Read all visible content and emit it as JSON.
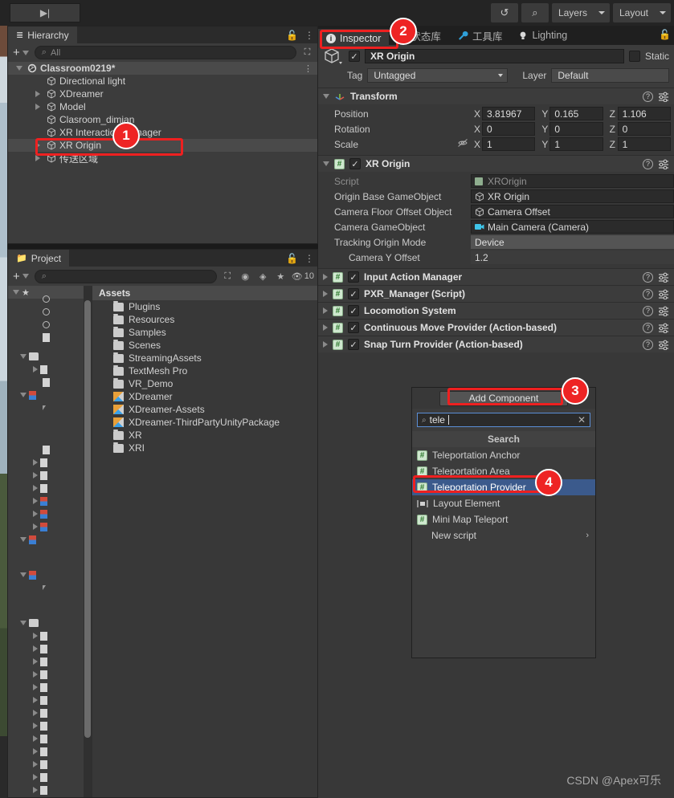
{
  "toolbar": {
    "play_icon": "▶",
    "step_icon": "▶|",
    "history_icon": "↺",
    "search_icon": "⌕",
    "layers_label": "Layers",
    "layout_label": "Layout"
  },
  "hierarchy": {
    "tab_label": "Hierarchy",
    "tab_icon": "list-icon",
    "add_label": "+",
    "search_placeholder": "All",
    "items": [
      {
        "label": "Classroom0219*",
        "depth": 0,
        "icon": "unity-scene-icon",
        "expanded": true,
        "arrow": "down",
        "selected": false,
        "menu": true
      },
      {
        "label": "Directional light",
        "depth": 2,
        "icon": "gameobject-icon",
        "arrow": "none",
        "selected": false
      },
      {
        "label": "XDreamer",
        "depth": 2,
        "icon": "gameobject-icon",
        "arrow": "right",
        "selected": false
      },
      {
        "label": "Model",
        "depth": 2,
        "icon": "gameobject-icon",
        "arrow": "right",
        "selected": false
      },
      {
        "label": "Clasroom_dimian",
        "depth": 2,
        "icon": "gameobject-icon",
        "arrow": "none",
        "selected": false
      },
      {
        "label": "XR Interaction Manager",
        "depth": 2,
        "icon": "gameobject-icon",
        "arrow": "none",
        "selected": false
      },
      {
        "label": "XR Origin",
        "depth": 2,
        "icon": "gameobject-icon",
        "arrow": "right",
        "selected": true
      },
      {
        "label": "传送区域",
        "depth": 2,
        "icon": "gameobject-icon",
        "arrow": "right",
        "selected": false
      }
    ]
  },
  "project": {
    "tab_label": "Project",
    "tab_icon": "folder-icon",
    "add_label": "+",
    "search_placeholder": "",
    "hidden_count": "10",
    "column_header": "Assets",
    "folders": [
      {
        "label": "Plugins",
        "icon": "folder-icon"
      },
      {
        "label": "Resources",
        "icon": "folder-icon"
      },
      {
        "label": "Samples",
        "icon": "folder-icon"
      },
      {
        "label": "Scenes",
        "icon": "folder-icon"
      },
      {
        "label": "StreamingAssets",
        "icon": "folder-icon"
      },
      {
        "label": "TextMesh Pro",
        "icon": "folder-icon"
      },
      {
        "label": "VR_Demo",
        "icon": "folder-icon"
      },
      {
        "label": "XDreamer",
        "icon": "package-icon"
      },
      {
        "label": "XDreamer-Assets",
        "icon": "package-icon"
      },
      {
        "label": "XDreamer-ThirdPartyUnityPackage",
        "icon": "package-icon"
      },
      {
        "label": "XR",
        "icon": "folder-icon"
      },
      {
        "label": "XRI",
        "icon": "folder-icon"
      }
    ]
  },
  "inspector": {
    "tabs": [
      {
        "label": "Inspector",
        "icon": "info-icon",
        "active": true
      },
      {
        "label": "状态库",
        "icon": "state-icon",
        "active": false
      },
      {
        "label": "工具库",
        "icon": "wrench-icon",
        "active": false
      },
      {
        "label": "Lighting",
        "icon": "bulb-icon",
        "active": false
      }
    ],
    "gameobject": {
      "enabled": true,
      "name": "XR Origin",
      "static_label": "Static",
      "static_checked": false,
      "tag_label": "Tag",
      "tag_value": "Untagged",
      "layer_label": "Layer",
      "layer_value": "Default"
    },
    "transform": {
      "title": "Transform",
      "icon": "transform-icon",
      "rows": [
        {
          "name": "Position",
          "x": "3.81967",
          "y": "0.165",
          "z": "1.106"
        },
        {
          "name": "Rotation",
          "x": "0",
          "y": "0",
          "z": "0"
        },
        {
          "name": "Scale",
          "x": "1",
          "y": "1",
          "z": "1",
          "link_icon": "constrained-proportions-off-icon"
        }
      ],
      "axis_labels": [
        "X",
        "Y",
        "Z"
      ]
    },
    "xr_origin": {
      "title": "XR Origin",
      "enabled": true,
      "fields": [
        {
          "label": "Script",
          "value": "XROrigin",
          "kind": "object",
          "dim": true,
          "icon": "script-icon"
        },
        {
          "label": "Origin Base GameObject",
          "value": "XR Origin",
          "kind": "object",
          "icon": "gameobject-icon"
        },
        {
          "label": "Camera Floor Offset Object",
          "value": "Camera Offset",
          "kind": "object",
          "icon": "gameobject-icon"
        },
        {
          "label": "Camera GameObject",
          "value": "Main Camera (Camera)",
          "kind": "object",
          "icon": "camera-icon"
        },
        {
          "label": "Tracking Origin Mode",
          "value": "Device",
          "kind": "enum"
        },
        {
          "label": "Camera Y Offset",
          "value": "1.2",
          "kind": "number",
          "indent": true
        }
      ]
    },
    "components": [
      {
        "title": "Input Action Manager",
        "enabled": true
      },
      {
        "title": "PXR_Manager (Script)",
        "enabled": true
      },
      {
        "title": "Locomotion System",
        "enabled": true
      },
      {
        "title": "Continuous Move Provider (Action-based)",
        "enabled": true
      },
      {
        "title": "Snap Turn Provider (Action-based)",
        "enabled": true
      }
    ]
  },
  "add_component": {
    "button_label": "Add Component",
    "search_value": "tele",
    "search_icon": "search-icon",
    "clear_icon": "clear-icon",
    "section_header": "Search",
    "results": [
      {
        "label": "Teleportation Anchor",
        "icon": "script-icon",
        "selected": false
      },
      {
        "label": "Teleportation Area",
        "icon": "script-icon",
        "selected": false
      },
      {
        "label": "Teleportation Provider",
        "icon": "script-icon",
        "selected": true
      },
      {
        "label": "Layout Element",
        "icon": "layout-icon",
        "selected": false
      },
      {
        "label": "Mini Map Teleport",
        "icon": "script-icon",
        "selected": false
      },
      {
        "label": "New script",
        "icon": "none",
        "selected": false,
        "submenu": true
      }
    ]
  },
  "annotations": [
    {
      "number": "1",
      "target": "hierarchy-item-xr-origin"
    },
    {
      "number": "2",
      "target": "inspector-tab"
    },
    {
      "number": "3",
      "target": "add-component-button"
    },
    {
      "number": "4",
      "target": "teleportation-provider-result"
    }
  ],
  "watermark": "CSDN @Apex可乐",
  "colors": {
    "accent_selection": "#3b5a8c",
    "annotation_red": "#ee2424",
    "panel_bg": "#383838",
    "header_bg": "#3c3c3c"
  }
}
